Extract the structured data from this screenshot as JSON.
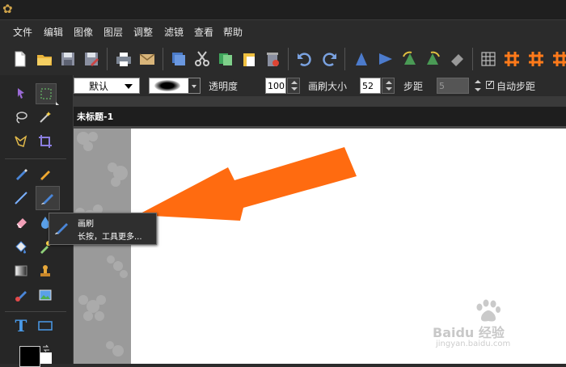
{
  "menu": [
    "文件",
    "编辑",
    "图像",
    "图层",
    "调整",
    "滤镜",
    "查看",
    "帮助"
  ],
  "options": {
    "preset": "默认",
    "opacity_label": "透明度",
    "opacity_value": "100",
    "brush_size_label": "画刷大小",
    "brush_size_value": "52",
    "step_label": "步距",
    "step_value": "5",
    "auto_step_label": "自动步距"
  },
  "tab": {
    "title": "未标题-1"
  },
  "tooltip": {
    "title": "画刷",
    "desc": "长按，工具更多..."
  },
  "watermark": {
    "text": "Baidu 经验",
    "url": "jingyan.baidu.com"
  },
  "colors": {
    "accent": "#ff6b10",
    "foreground": "#000000",
    "background": "#ffffff"
  }
}
